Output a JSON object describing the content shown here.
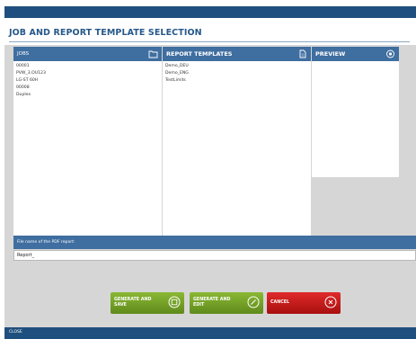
{
  "window": {
    "title": "JOB AND REPORT TEMPLATE SELECTION"
  },
  "jobs": {
    "header": "JOBS",
    "items": [
      "00001",
      "PVW_3.OU123",
      "LG-ST 60H",
      "00008",
      "Duplex"
    ]
  },
  "templates": {
    "header": "REPORT TEMPLATES",
    "items": [
      "Demo_DEU",
      "Demo_ENG",
      "TestLimits"
    ]
  },
  "preview": {
    "header": "PREVIEW"
  },
  "filename": {
    "label": "File name of the PDF report:",
    "value": "Report_"
  },
  "buttons": {
    "generate_save": "GENERATE AND SAVE",
    "generate_edit": "GENERATE AND EDIT",
    "cancel": "CANCEL"
  },
  "status": {
    "text": "CLOSE"
  },
  "colors": {
    "title_bar": "#1f4f7e",
    "panel_header": "#3f6ea0",
    "background": "#d6d6d6",
    "button_green": "#6e9c24",
    "button_red": "#c41e1e"
  }
}
